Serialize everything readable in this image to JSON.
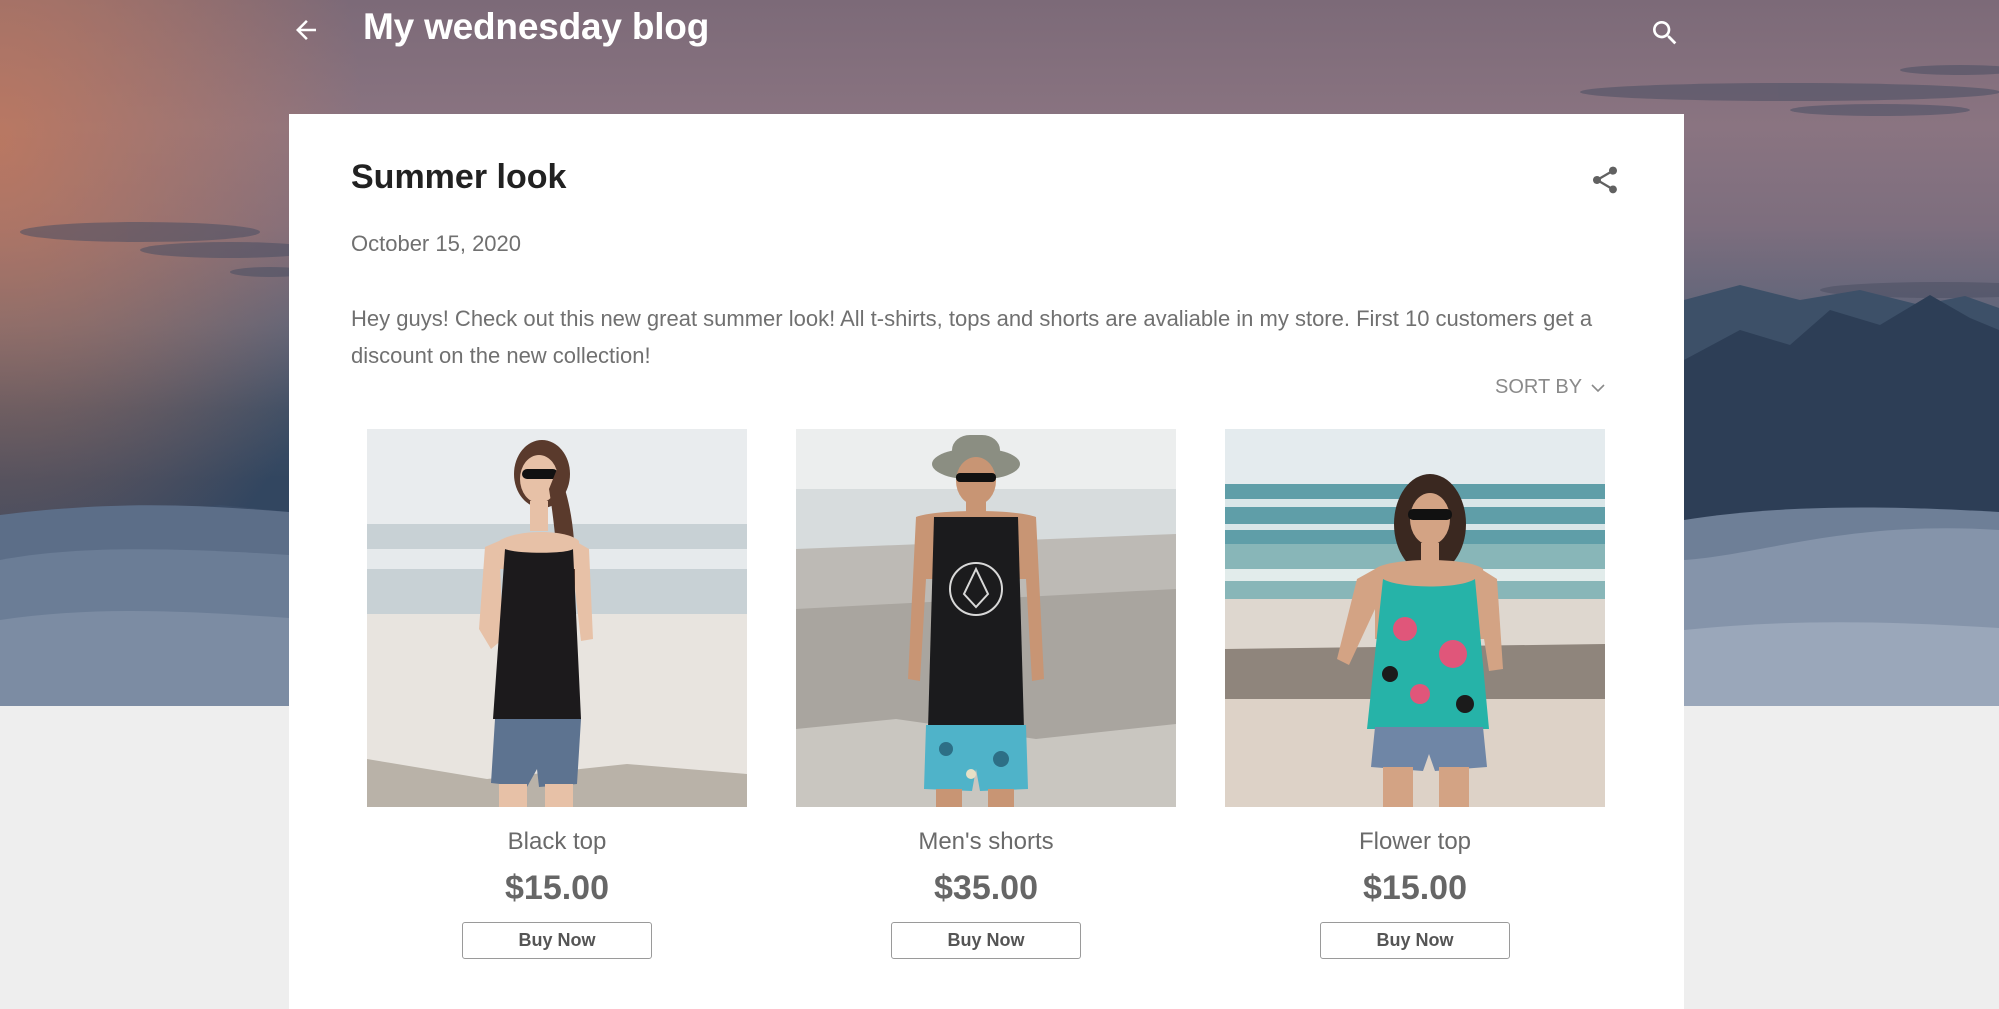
{
  "header": {
    "title": "My wednesday blog",
    "back_icon": "arrow-left-icon",
    "search_icon": "search-icon"
  },
  "post": {
    "title": "Summer look",
    "date": "October 15, 2020",
    "body": "Hey guys! Check out this new great summer look! All t-shirts, tops and shorts are avaliable in my store. First 10 customers get a discount on the new collection!",
    "share_icon": "share-icon"
  },
  "store": {
    "sort_label": "SORT BY",
    "products": [
      {
        "name": "Black top",
        "price": "$15.00",
        "button": "Buy Now"
      },
      {
        "name": "Men's shorts",
        "price": "$35.00",
        "button": "Buy Now"
      },
      {
        "name": "Flower top",
        "price": "$15.00",
        "button": "Buy Now"
      }
    ]
  },
  "colors": {
    "card_background": "#ffffff",
    "page_background": "#eeeeee",
    "text_primary": "#212121",
    "text_secondary": "#707070"
  }
}
